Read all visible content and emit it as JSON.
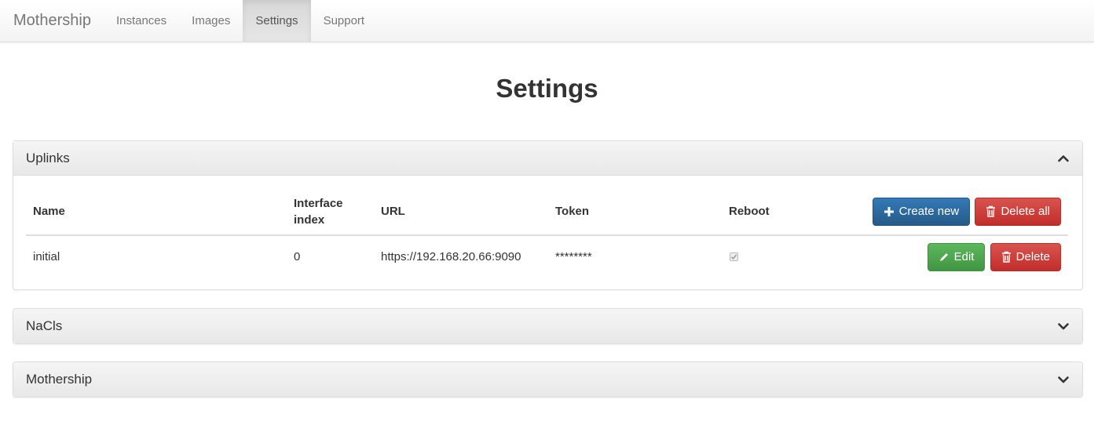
{
  "navbar": {
    "brand": "Mothership",
    "links": [
      {
        "label": "Instances",
        "active": false
      },
      {
        "label": "Images",
        "active": false
      },
      {
        "label": "Settings",
        "active": true
      },
      {
        "label": "Support",
        "active": false
      }
    ]
  },
  "page": {
    "title": "Settings"
  },
  "uplinks": {
    "heading": "Uplinks",
    "expanded": true,
    "columns": [
      "Name",
      "Interface index",
      "URL",
      "Token",
      "Reboot"
    ],
    "create_label": "Create new",
    "delete_all_label": "Delete all",
    "rows": [
      {
        "name": "initial",
        "interface_index": "0",
        "url": "https://192.168.20.66:9090",
        "token": "********",
        "reboot": true,
        "edit_label": "Edit",
        "delete_label": "Delete"
      }
    ]
  },
  "nacls": {
    "heading": "NaCls",
    "expanded": false
  },
  "mothership": {
    "heading": "Mothership",
    "expanded": false
  },
  "colors": {
    "primary": "#337ab7",
    "danger": "#d9534f",
    "success": "#5cb85c"
  },
  "icons": [
    "chevron-up-icon",
    "chevron-down-icon",
    "plus-icon",
    "trash-icon",
    "pencil-icon",
    "checkbox-checked-icon"
  ]
}
